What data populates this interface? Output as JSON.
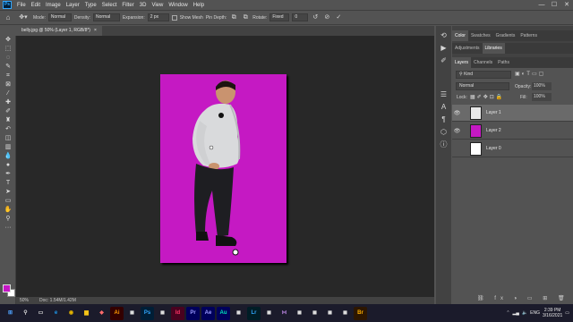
{
  "menubar": {
    "logo": "Ps",
    "items": [
      "File",
      "Edit",
      "Image",
      "Layer",
      "Type",
      "Select",
      "Filter",
      "3D",
      "View",
      "Window",
      "Help"
    ]
  },
  "window_controls": {
    "minimize": "—",
    "maximize": "☐",
    "close": "✕"
  },
  "options": {
    "mode_label": "Mode:",
    "mode_value": "Normal",
    "density_label": "Density:",
    "density_value": "Normal",
    "expansion_label": "Expansion:",
    "expansion_value": "2 px",
    "show_mesh_label": "Show Mesh",
    "pin_depth_label": "Pin Depth:",
    "rotate_label": "Rotate:",
    "rotate_value": "Fixed",
    "rotate_angle": "0"
  },
  "document_tab": {
    "title": "belly.jpg @ 50% (Layer 1, RGB/8*)",
    "close": "×"
  },
  "status": {
    "zoom": "50%",
    "doc": "Doc: 1.54M/1.42M"
  },
  "panels": {
    "top_tabs": [
      "Color",
      "Swatches",
      "Gradients",
      "Patterns"
    ],
    "mid_tabs": [
      "Adjustments",
      "Libraries"
    ],
    "layer_tabs": [
      "Layers",
      "Channels",
      "Paths"
    ],
    "kind_label": "Kind",
    "blend_mode": "Normal",
    "opacity_label": "Opacity:",
    "opacity_value": "100%",
    "lock_label": "Lock:",
    "fill_label": "Fill:",
    "fill_value": "100%",
    "layers": [
      {
        "name": "Layer 1",
        "visible": true,
        "selected": true,
        "thumb_color": "#e8e8e8"
      },
      {
        "name": "Layer 2",
        "visible": true,
        "selected": false,
        "thumb_color": "#c519c3"
      },
      {
        "name": "Layer 0",
        "visible": false,
        "selected": false,
        "thumb_color": "#ffffff"
      }
    ]
  },
  "taskbar": {
    "apps": [
      "Ai",
      "Ps",
      "Id",
      "Pr",
      "Ae",
      "Au",
      "Lr",
      "Br"
    ],
    "lang": "ENG",
    "time": "2:39 PM",
    "date": "3/16/2021"
  },
  "colors": {
    "canvas_bg": "#c519c3",
    "foreground": "#c516c5",
    "background": "#ffffff"
  }
}
